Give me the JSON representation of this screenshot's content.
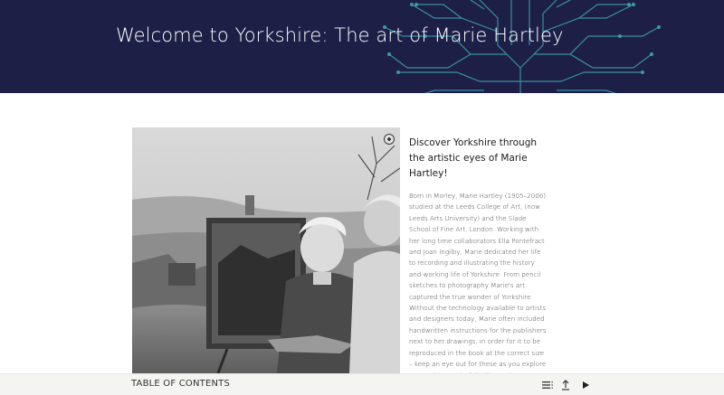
{
  "banner": {
    "title": "Welcome to Yorkshire: The art of Marie Hartley",
    "background": "#1d1f47",
    "art_color": "#3fa3b0"
  },
  "photo": {
    "alt": "Black and white photograph of Marie Hartley painting outdoors on a hillside",
    "zoom_icon": "zoom-in-icon"
  },
  "article": {
    "heading": "Discover Yorkshire through the artistic eyes of Marie Hartley!",
    "body": "Born in Morley, Marie Hartley (1905–2006) studied at the Leeds College of Art, (now Leeds Arts University) and the Slade School of Fine Art, London. Working with her long time collaborators Ella Pontefract and Joan Ingilby, Marie dedicated her life to recording and illustrating the history and working life of Yorkshire. From pencil sketches to photography Marie's art captured the true wonder of Yorkshire. Without the technology available to artists and designers today, Marie often included handwritten instructions for the publishers next to her drawings, in order for it to be reproduced in the book at the correct size – keep an eye out for these as you explore more. This wonderfully illustrative collection is housed at the University of"
  },
  "footer": {
    "toc_label": "TABLE OF CONTENTS",
    "icons": [
      "list-icon",
      "share-icon",
      "play-icon"
    ]
  }
}
